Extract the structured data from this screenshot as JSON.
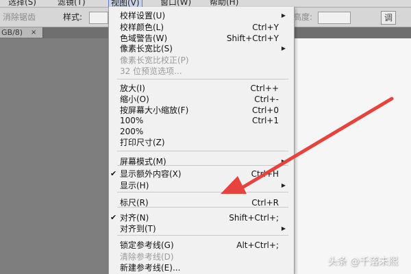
{
  "menubar": {
    "items": [
      {
        "label": "选择(S)"
      },
      {
        "label": "滤镜(T)"
      },
      {
        "label": "视图(V)"
      },
      {
        "label": "窗口(W)"
      },
      {
        "label": "帮助(H)"
      }
    ]
  },
  "options": {
    "antialias_label": "消除锯齿",
    "style_label": "样式:",
    "height_label": "高度:",
    "adjust_label": "调"
  },
  "document_tab": {
    "caption": "GB/8)",
    "close": "×"
  },
  "view_menu": {
    "items": [
      {
        "label": "校样设置(U)",
        "shortcut": "",
        "submenu": true,
        "disabled": false,
        "checked": false
      },
      {
        "label": "校样颜色(L)",
        "shortcut": "Ctrl+Y",
        "submenu": false,
        "disabled": false,
        "checked": false
      },
      {
        "label": "色域警告(W)",
        "shortcut": "Shift+Ctrl+Y",
        "submenu": false,
        "disabled": false,
        "checked": false
      },
      {
        "label": "像素长宽比(S)",
        "shortcut": "",
        "submenu": true,
        "disabled": false,
        "checked": false
      },
      {
        "label": "像素长宽比校正(P)",
        "shortcut": "",
        "submenu": false,
        "disabled": true,
        "checked": false
      },
      {
        "label": "32 位预览选项...",
        "shortcut": "",
        "submenu": false,
        "disabled": true,
        "checked": false
      },
      {
        "label": "放大(I)",
        "shortcut": "Ctrl++",
        "submenu": false,
        "disabled": false,
        "checked": false
      },
      {
        "label": "缩小(O)",
        "shortcut": "Ctrl+-",
        "submenu": false,
        "disabled": false,
        "checked": false
      },
      {
        "label": "按屏幕大小缩放(F)",
        "shortcut": "Ctrl+0",
        "submenu": false,
        "disabled": false,
        "checked": false
      },
      {
        "label": "100%",
        "shortcut": "Ctrl+1",
        "submenu": false,
        "disabled": false,
        "checked": false
      },
      {
        "label": "200%",
        "shortcut": "",
        "submenu": false,
        "disabled": false,
        "checked": false
      },
      {
        "label": "打印尺寸(Z)",
        "shortcut": "",
        "submenu": false,
        "disabled": false,
        "checked": false
      },
      {
        "label": "屏幕模式(M)",
        "shortcut": "",
        "submenu": true,
        "disabled": false,
        "checked": false
      },
      {
        "label": "显示额外内容(X)",
        "shortcut": "Ctrl+H",
        "submenu": false,
        "disabled": false,
        "checked": true
      },
      {
        "label": "显示(H)",
        "shortcut": "",
        "submenu": true,
        "disabled": false,
        "checked": false
      },
      {
        "label": "标尺(R)",
        "shortcut": "Ctrl+R",
        "submenu": false,
        "disabled": false,
        "checked": false
      },
      {
        "label": "对齐(N)",
        "shortcut": "Shift+Ctrl+;",
        "submenu": false,
        "disabled": false,
        "checked": true
      },
      {
        "label": "对齐到(T)",
        "shortcut": "",
        "submenu": true,
        "disabled": false,
        "checked": false
      },
      {
        "label": "锁定参考线(G)",
        "shortcut": "Alt+Ctrl+;",
        "submenu": false,
        "disabled": false,
        "checked": false
      },
      {
        "label": "清除参考线(D)",
        "shortcut": "",
        "submenu": false,
        "disabled": true,
        "checked": false
      },
      {
        "label": "新建参考线(E)...",
        "shortcut": "",
        "submenu": false,
        "disabled": false,
        "checked": false
      }
    ]
  },
  "glyphs": {
    "check": "✔",
    "submenu_arrow": "▶"
  },
  "annotation": {
    "arrow_color": "#e8423c",
    "points_to": "标尺(R)"
  },
  "watermark": "头条 @千落未熙"
}
